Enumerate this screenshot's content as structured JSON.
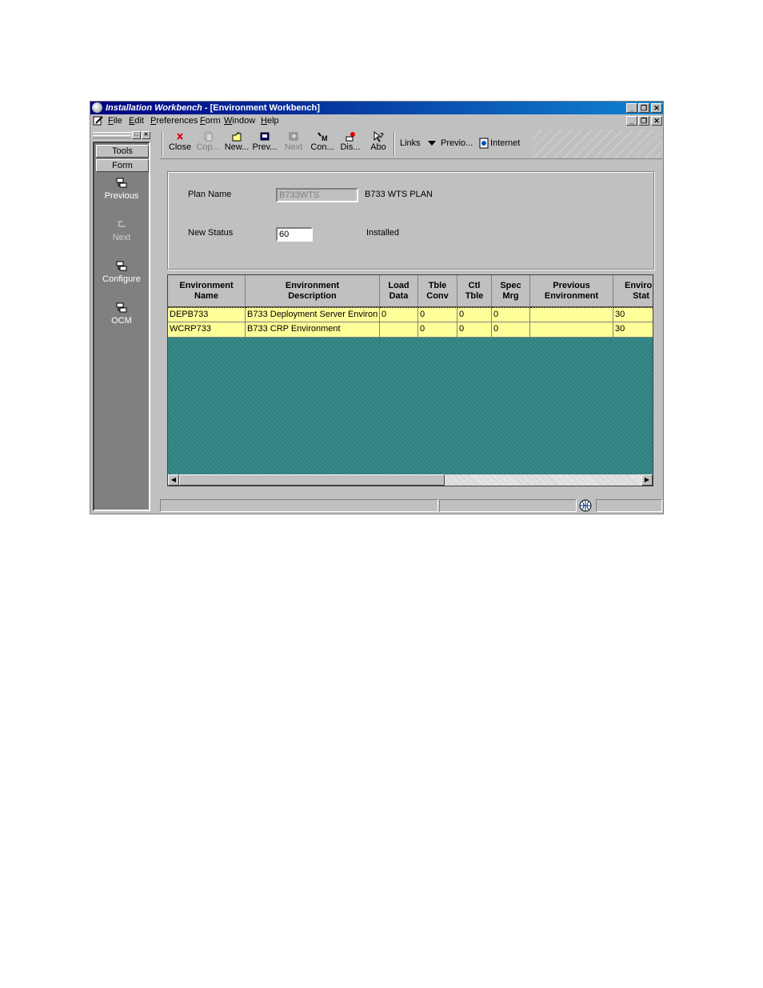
{
  "window": {
    "title_app": "Installation Workbench",
    "title_form": " - [Environment Workbench]"
  },
  "menu": [
    "File",
    "Edit",
    "Preferences",
    "Form",
    "Window",
    "Help"
  ],
  "left_panel": {
    "tabs": [
      "Tools",
      "Form"
    ],
    "items": [
      {
        "label": "Previous",
        "icon": "form-exit-icon"
      },
      {
        "label": "Next",
        "icon": "form-exit-icon"
      },
      {
        "label": "Configure",
        "icon": "form-exit-icon"
      },
      {
        "label": "OCM",
        "icon": "form-exit-icon"
      }
    ]
  },
  "toolbar": {
    "buttons": [
      {
        "label": "Close",
        "icon": "close-x-icon"
      },
      {
        "label": "Cop...",
        "icon": "copy-icon"
      },
      {
        "label": "New...",
        "icon": "new-icon"
      },
      {
        "label": "Prev...",
        "icon": "previous-icon"
      },
      {
        "label": "Next",
        "icon": "next-icon"
      },
      {
        "label": "Con...",
        "icon": "configure-icon"
      },
      {
        "label": "Dis...",
        "icon": "display-icon"
      },
      {
        "label": "Abo",
        "icon": "about-icon"
      }
    ],
    "links_label": "Links",
    "previous_link": "Previo...",
    "internet_label": "Internet"
  },
  "form": {
    "plan_name_label": "Plan Name",
    "plan_name_value": "B733WTS",
    "plan_desc": "B733 WTS PLAN",
    "new_status_label": "New Status",
    "new_status_value": "60",
    "new_status_desc": "Installed"
  },
  "grid": {
    "columns": [
      "Environment\nName",
      "Environment\nDescription",
      "Load\nData",
      "Tble\nConv",
      "Ctl\nTble",
      "Spec\nMrg",
      "Previous\nEnvironment",
      "Environ\nStat"
    ],
    "rows": [
      [
        "DEPB733",
        "B733 Deployment Server Environ",
        "0",
        "0",
        "0",
        "0",
        "",
        "30"
      ],
      [
        "WCRP733",
        "B733 CRP Environment",
        "",
        "0",
        "0",
        "0",
        "",
        "30"
      ]
    ]
  },
  "colors": {
    "title_bar": "#000080",
    "grid_background": "#2f7f7f",
    "row_highlight": "#ffff99"
  }
}
